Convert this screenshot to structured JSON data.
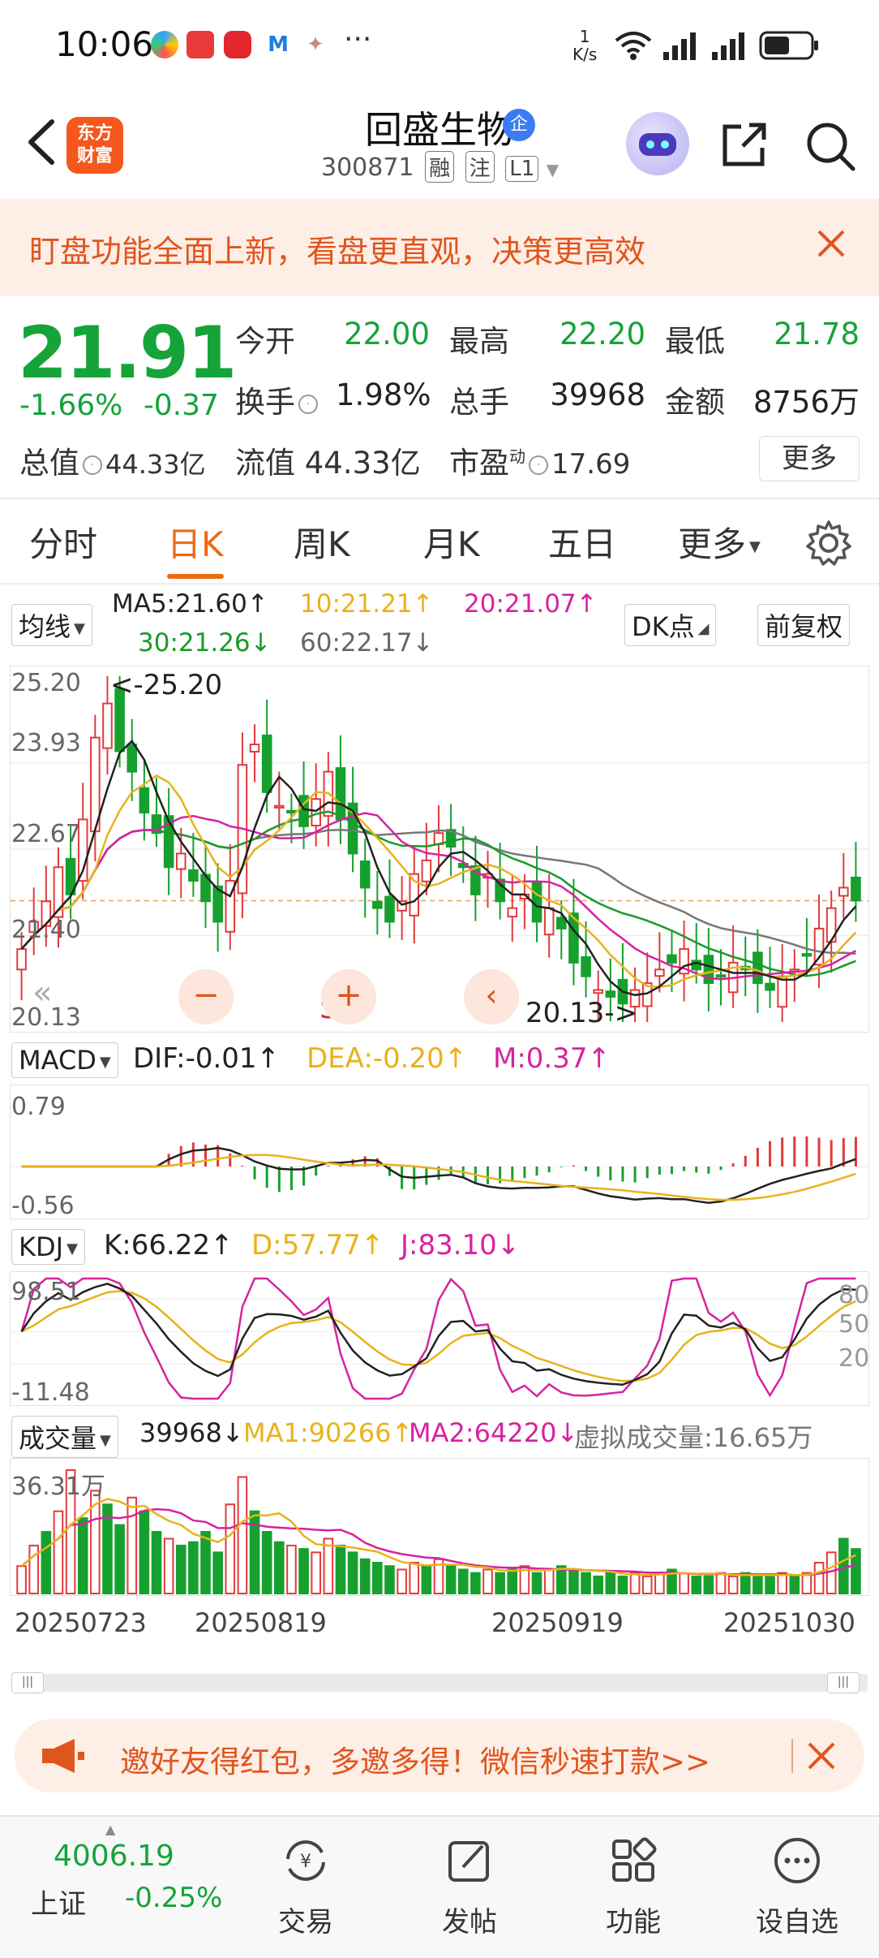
{
  "status_bar": {
    "time": "10:06",
    "more_dots": "···",
    "speed_value": "1",
    "speed_unit": "K/s",
    "icons": [
      "wifi-icon",
      "signal-icon",
      "signal-icon",
      "battery-icon"
    ]
  },
  "header": {
    "back_icon": "back-arrow-icon",
    "logo_text_1": "东方",
    "logo_text_2": "财富",
    "stock_name": "回盛生物",
    "qi_badge": "企",
    "stock_code": "300871",
    "tag_rong": "融",
    "tag_zhu": "注",
    "tag_l1": "L1",
    "share_icon": "share-icon",
    "search_icon": "search-icon"
  },
  "promo_banner": {
    "text": "盯盘功能全面上新，看盘更直观，决策更高效"
  },
  "quote": {
    "price": "21.91",
    "change_pct": "-1.66%",
    "change": "-0.37",
    "open_label": "今开",
    "open": "22.00",
    "high_label": "最高",
    "high": "22.20",
    "low_label": "最低",
    "low": "21.78",
    "turnover_label": "换手",
    "turnover": "1.98%",
    "volume_label": "总手",
    "volume": "39968",
    "amount_label": "金额",
    "amount": "8756万",
    "mktcap_label": "总值",
    "mktcap": "44.33亿",
    "float_label": "流值",
    "float_cap": "44.33亿",
    "pe_label": "市盈",
    "pe_sup": "动",
    "pe": "17.69",
    "more_button": "更多"
  },
  "tabs": [
    {
      "label": "分时",
      "active": false
    },
    {
      "label": "日K",
      "active": true
    },
    {
      "label": "周K",
      "active": false
    },
    {
      "label": "月K",
      "active": false
    },
    {
      "label": "五日",
      "active": false
    },
    {
      "label": "更多",
      "active": false
    }
  ],
  "ma_legend": {
    "selector": "均线",
    "ma5": "MA5:21.60↑",
    "ma10": "10:21.21↑",
    "ma20": "20:21.07↑",
    "ma30": "30:21.26↓",
    "ma60": "60:22.17↓",
    "dk_button": "DK点",
    "adjust_button": "前复权",
    "colors": {
      "ma5": "#222222",
      "ma10": "#e9b21b",
      "ma20": "#d6239f",
      "ma30": "#1a9a2b",
      "ma60": "#777777"
    }
  },
  "kline": {
    "y_labels": [
      "25.20",
      "23.93",
      "22.67",
      "21.40",
      "20.13"
    ],
    "high_marker": "<-25.20",
    "low_marker": "20.13->",
    "s_label": "S"
  },
  "macd": {
    "selector": "MACD",
    "dif": "DIF:-0.01↑",
    "dea": "DEA:-0.20↑",
    "m": "M:0.37↑",
    "y_top": "0.79",
    "y_bottom": "-0.56"
  },
  "kdj": {
    "selector": "KDJ",
    "k": "K:66.22↑",
    "d": "D:57.77↑",
    "j": "J:83.10↓",
    "y_top": "98.51",
    "y_bottom": "-11.48",
    "levels": [
      "80",
      "50",
      "20"
    ]
  },
  "volume": {
    "selector": "成交量",
    "vol": "39968↓",
    "ma1": "MA1:90266↑",
    "ma2": "MA2:64220↓",
    "virtual": "虚拟成交量:16.65万",
    "y_top": "36.31万"
  },
  "dates": [
    "20250723",
    "20250819",
    "20250919",
    "20251030"
  ],
  "invite_banner": {
    "text": "邀好友得红包，多邀多得！微信秒速打款>>"
  },
  "bottom_bar": {
    "index_value": "4006.19",
    "index_name": "上证",
    "index_change": "-0.25%",
    "nav": [
      {
        "label": "交易",
        "icon": "trade-icon"
      },
      {
        "label": "发帖",
        "icon": "post-icon"
      },
      {
        "label": "功能",
        "icon": "apps-icon"
      },
      {
        "label": "设自选",
        "icon": "add-watchlist-icon"
      }
    ]
  },
  "chart_data": {
    "type": "candlestick",
    "x_axis_labels": [
      "20250723",
      "20250819",
      "20250919",
      "20251030"
    ],
    "ylim": [
      20.13,
      25.2
    ],
    "y_ticks": [
      25.2,
      23.93,
      22.67,
      21.4,
      20.13
    ],
    "period_high": 25.2,
    "period_low": 20.13,
    "last_close": 21.91,
    "moving_averages": [
      {
        "name": "MA5",
        "value": 21.6
      },
      {
        "name": "MA10",
        "value": 21.21
      },
      {
        "name": "MA20",
        "value": 21.07
      },
      {
        "name": "MA30",
        "value": 21.26
      },
      {
        "name": "MA60",
        "value": 22.17
      }
    ],
    "closes": [
      21.2,
      21.6,
      21.9,
      22.4,
      22.0,
      23.1,
      24.3,
      24.8,
      24.1,
      23.8,
      23.2,
      22.9,
      22.4,
      22.6,
      22.2,
      21.9,
      21.6,
      22.2,
      23.9,
      24.2,
      23.5,
      23.3,
      23.2,
      23.0,
      23.4,
      23.8,
      23.1,
      22.6,
      22.1,
      21.8,
      21.6,
      21.9,
      22.3,
      22.5,
      22.9,
      22.7,
      22.4,
      22.0,
      22.3,
      21.9,
      21.8,
      22.0,
      21.6,
      21.8,
      21.5,
      21.0,
      20.8,
      20.6,
      20.5,
      20.4,
      20.6,
      20.7,
      20.9,
      21.0,
      21.2,
      20.9,
      20.7,
      20.8,
      21.0,
      20.9,
      20.7,
      20.6,
      20.8,
      20.9,
      21.1,
      21.5,
      21.8,
      22.1,
      21.91
    ],
    "macd": {
      "dif": -0.01,
      "dea": -0.2,
      "m": 0.37,
      "ylim": [
        -0.56,
        0.79
      ]
    },
    "kdj": {
      "k": 66.22,
      "d": 57.77,
      "j": 83.1,
      "ylim": [
        -11.48,
        98.51
      ]
    },
    "volume": {
      "last": 39968,
      "ma1": 90266,
      "ma2": 64220,
      "ymax_label": "36.31万",
      "values": [
        8,
        14,
        18,
        24,
        36,
        22,
        30,
        26,
        20,
        28,
        24,
        18,
        16,
        14,
        15,
        18,
        12,
        26,
        34,
        24,
        18,
        15,
        14,
        13,
        12,
        16,
        14,
        12,
        10,
        9,
        8,
        7,
        9,
        8,
        10,
        8,
        7,
        6,
        7,
        6,
        7,
        8,
        6,
        7,
        8,
        7,
        6,
        5,
        6,
        5,
        6,
        5,
        6,
        7,
        6,
        5,
        5,
        6,
        5,
        6,
        5,
        5,
        6,
        5,
        6,
        9,
        12,
        16,
        13
      ],
      "colors": [
        "r",
        "r",
        "g",
        "r",
        "r",
        "g",
        "r",
        "g",
        "g",
        "r",
        "g",
        "g",
        "r",
        "g",
        "g",
        "g",
        "g",
        "r",
        "r",
        "g",
        "g",
        "g",
        "r",
        "g",
        "r",
        "r",
        "g",
        "g",
        "g",
        "g",
        "g",
        "r",
        "r",
        "g",
        "r",
        "g",
        "g",
        "g",
        "r",
        "g",
        "g",
        "r",
        "g",
        "r",
        "g",
        "g",
        "g",
        "g",
        "g",
        "g",
        "r",
        "r",
        "r",
        "g",
        "r",
        "g",
        "g",
        "r",
        "r",
        "g",
        "g",
        "g",
        "r",
        "g",
        "r",
        "r",
        "r",
        "g",
        "g"
      ]
    }
  }
}
